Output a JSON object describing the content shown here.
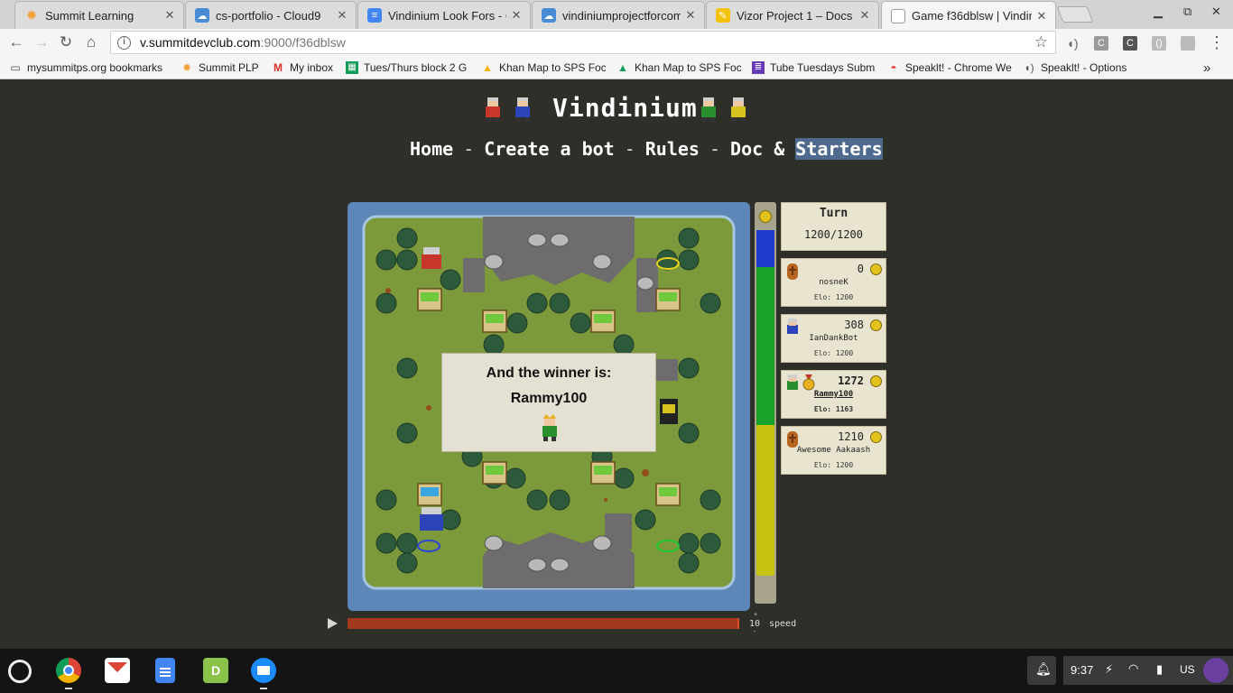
{
  "browser": {
    "tabs": [
      {
        "title": "Summit Learning",
        "icon": "summit-sun-icon",
        "color": "#f2a23b"
      },
      {
        "title": "cs-portfolio - Cloud9",
        "icon": "cloud9-icon",
        "color": "#4a8bd6"
      },
      {
        "title": "Vindinium Look Fors - Go",
        "icon": "google-docs-icon",
        "color": "#4285f4"
      },
      {
        "title": "vindiniumprojectforcom",
        "icon": "cloud9-icon",
        "color": "#4a8bd6"
      },
      {
        "title": "Vizor Project 1 – Docs –",
        "icon": "pencil-icon",
        "color": "#f4c20d"
      },
      {
        "title": "Game f36dblsw | Vindini",
        "icon": "page-icon",
        "color": "#9e9e9e"
      }
    ],
    "url_host": "v.summitdevclub.com",
    "url_rest": ":9000/f36dblsw",
    "extensions": [
      "C",
      "C",
      "()"
    ],
    "bookmarks": [
      {
        "label": "mysummitps.org bookmarks",
        "icon": "folder-icon"
      },
      {
        "label": "Summit PLP",
        "icon": "summit-sun-icon"
      },
      {
        "label": "My inbox",
        "icon": "gmail-icon"
      },
      {
        "label": "Tues/Thurs block 2 G",
        "icon": "sheets-icon"
      },
      {
        "label": "Khan Map to SPS Foc",
        "icon": "drive-icon"
      },
      {
        "label": "Khan Map to SPS Foc",
        "icon": "drive-icon"
      },
      {
        "label": "Tube Tuesdays Subm",
        "icon": "forms-icon"
      },
      {
        "label": "Speaklt! - Chrome We",
        "icon": "webstore-icon"
      },
      {
        "label": "Speaklt! - Options",
        "icon": "speaker-icon"
      }
    ],
    "overflow": "»"
  },
  "site": {
    "title": "Vindinium",
    "nav": [
      "Home",
      "Create a bot",
      "Rules",
      "Doc & ",
      "Starters"
    ],
    "nav_sep": "-"
  },
  "game": {
    "turn_label": "Turn",
    "turn_value": "1200/1200",
    "winner_heading": "And the winner is:",
    "winner_name": "Rammy100",
    "players": [
      {
        "name": "nosneK",
        "gold": "0",
        "elo": "Elo: 1200",
        "color": "#c8352a",
        "dead": true
      },
      {
        "name": "IanDankBot",
        "gold": "308",
        "elo": "Elo: 1200",
        "color": "#2c44b8",
        "dead": false
      },
      {
        "name": "Rammy100",
        "gold": "1272",
        "elo": "Elo: 1163",
        "color": "#2a8f2f",
        "dead": false,
        "winner": true
      },
      {
        "name": "Awesome Aakaash",
        "gold": "1210",
        "elo": "Elo: 1200",
        "color": "#d6c21f",
        "dead": true
      }
    ],
    "gold_share": {
      "blue": 0.1,
      "green": 0.43,
      "yellow": 0.41
    },
    "colors": {
      "blue": "#1f3bd0",
      "green": "#1aa32a",
      "yellow": "#c6c410",
      "red": "#c8352a"
    },
    "speed_value": "10",
    "speed_label": "speed",
    "progress": 1.0
  },
  "shelf": {
    "apps": [
      "chrome-icon",
      "gmail-icon",
      "docs-icon",
      "d-app-icon",
      "files-icon"
    ],
    "time": "9:37",
    "locale": "US"
  }
}
